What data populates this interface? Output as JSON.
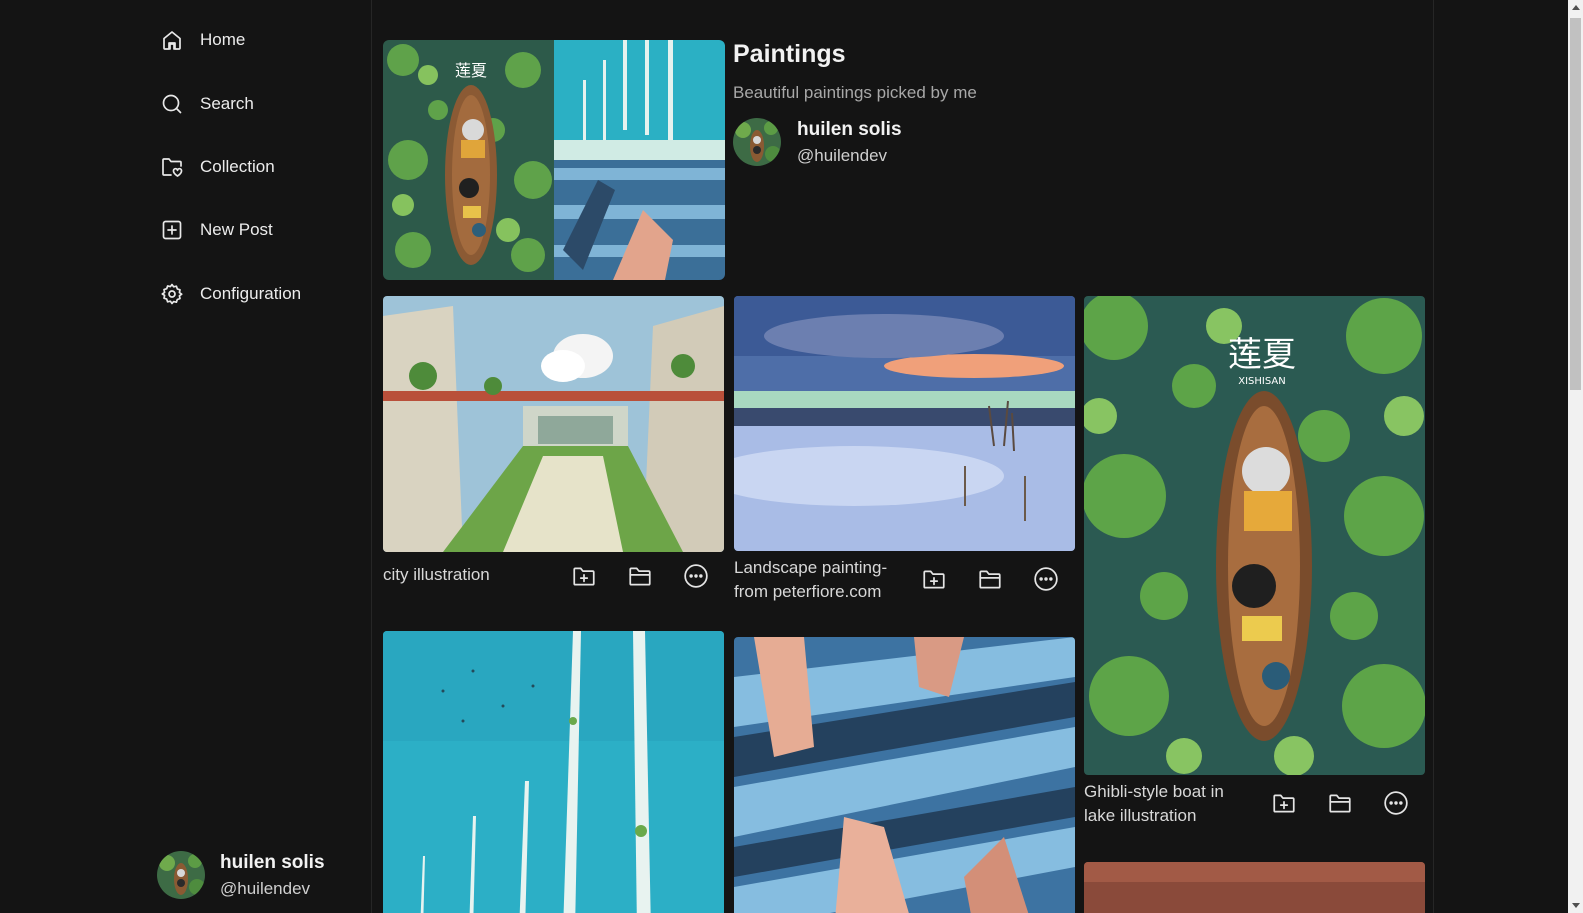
{
  "sidebar": {
    "items": [
      {
        "label": "Home",
        "icon": "home-icon"
      },
      {
        "label": "Search",
        "icon": "search-icon"
      },
      {
        "label": "Collection",
        "icon": "folder-heart-icon"
      },
      {
        "label": "New Post",
        "icon": "plus-square-icon"
      },
      {
        "label": "Configuration",
        "icon": "gear-icon"
      }
    ],
    "user": {
      "name": "huilen solis",
      "handle": "@huilendev"
    }
  },
  "collection": {
    "title": "Paintings",
    "description": "Beautiful paintings picked by me",
    "owner": {
      "name": "huilen solis",
      "handle": "@huilendev"
    }
  },
  "posts": [
    {
      "caption": "city illustration"
    },
    {
      "caption_lines": [
        "Landscape painting-",
        "from peterfiore.com"
      ]
    },
    {
      "caption_lines": [
        "Ghibli-style boat in",
        "lake illustration"
      ]
    }
  ],
  "colors": {
    "background": "#141414",
    "text": "#e8e8e8",
    "muted": "#a8a8a8"
  }
}
